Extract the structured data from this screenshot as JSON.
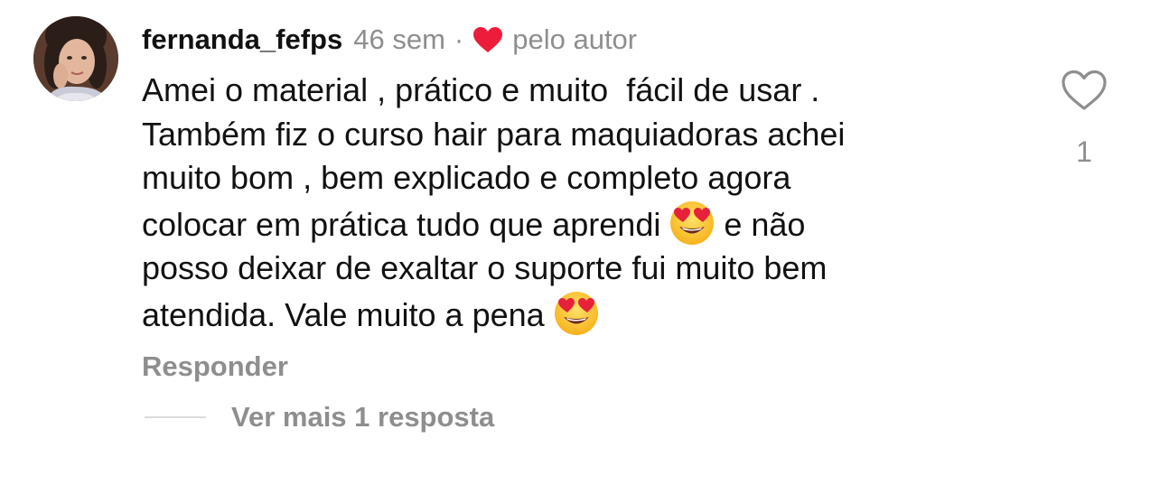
{
  "comment": {
    "username": "fernanda_fefps",
    "time_ago": "46 sem",
    "separator": "·",
    "liked_by_author_label": "pelo autor",
    "body_lines": [
      "Amei o material , prático e muito  fácil de usar .",
      "Também fiz o curso hair para maquiadoras achei",
      "muito bom , bem explicado e completo agora",
      "colocar em prática tudo que aprendi ",
      " e não",
      "posso deixar de exaltar o suporte fui muito bem",
      "atendida. Vale muito a pena "
    ],
    "emoji_name": "smiling-face-with-heart-eyes",
    "like_count": "1",
    "reply_label": "Responder",
    "view_replies_label": "Ver mais 1 resposta"
  },
  "icons": {
    "avatar": "profile-photo",
    "author_heart": "heart-filled-icon",
    "like": "heart-outline-icon"
  },
  "colors": {
    "text_primary": "#111111",
    "text_secondary": "#8e8e8e",
    "heart_red": "#ed1c3b",
    "divider": "#dbdbdb"
  }
}
